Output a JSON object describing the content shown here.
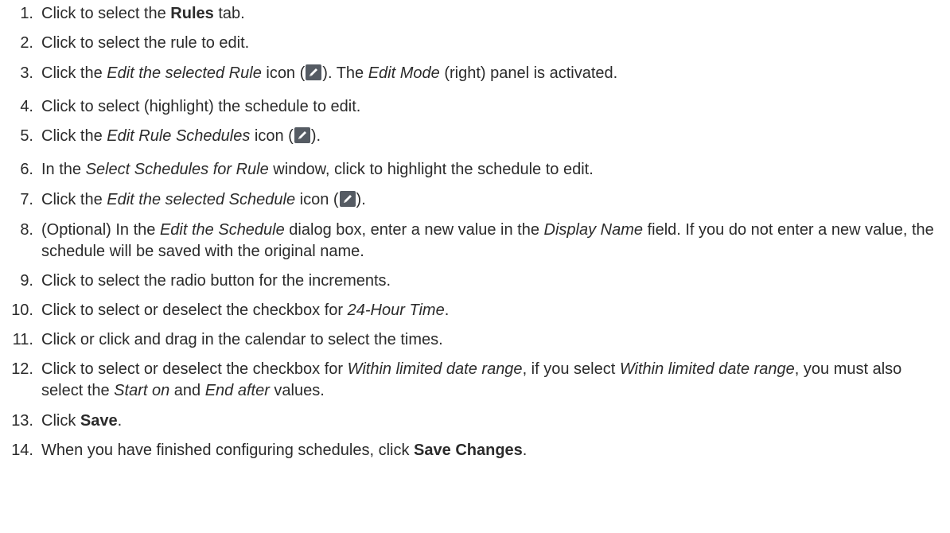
{
  "steps": [
    {
      "num": "1.",
      "parts": [
        {
          "t": "Click to select the "
        },
        {
          "t": "Rules",
          "s": "b"
        },
        {
          "t": " tab."
        }
      ]
    },
    {
      "num": "2.",
      "parts": [
        {
          "t": "Click to select the rule to edit."
        }
      ]
    },
    {
      "num": "3.",
      "parts": [
        {
          "t": "Click the "
        },
        {
          "t": "Edit the selected Rule",
          "s": "i"
        },
        {
          "t": " icon ("
        },
        {
          "icon": "pencil-edit-icon"
        },
        {
          "t": "). The "
        },
        {
          "t": "Edit Mode",
          "s": "i"
        },
        {
          "t": " (right) panel is activated."
        }
      ]
    },
    {
      "num": "4.",
      "parts": [
        {
          "t": "Click to select (highlight) the schedule to edit."
        }
      ]
    },
    {
      "num": "5.",
      "parts": [
        {
          "t": "Click the "
        },
        {
          "t": "Edit Rule Schedules",
          "s": "i"
        },
        {
          "t": " icon ("
        },
        {
          "icon": "pencil-edit-icon"
        },
        {
          "t": ")."
        }
      ]
    },
    {
      "num": "6.",
      "parts": [
        {
          "t": "In the "
        },
        {
          "t": "Select Schedules for Rule",
          "s": "i"
        },
        {
          "t": " window, click to highlight the schedule to edit."
        }
      ]
    },
    {
      "num": "7.",
      "parts": [
        {
          "t": "Click the "
        },
        {
          "t": "Edit the selected Schedule",
          "s": "i"
        },
        {
          "t": " icon ("
        },
        {
          "icon": "pencil-edit-icon"
        },
        {
          "t": ")."
        }
      ]
    },
    {
      "num": "8.",
      "parts": [
        {
          "t": "(Optional) In the "
        },
        {
          "t": "Edit the Schedule",
          "s": "i"
        },
        {
          "t": " dialog box, enter a new value in the "
        },
        {
          "t": "Display Name",
          "s": "i"
        },
        {
          "t": " field. If you do not enter a new value, the schedule will be saved with the original name."
        }
      ]
    },
    {
      "num": "9.",
      "parts": [
        {
          "t": "Click to select the radio button for the increments."
        }
      ]
    },
    {
      "num": "10.",
      "parts": [
        {
          "t": "Click to select or deselect the checkbox for "
        },
        {
          "t": "24-Hour Time",
          "s": "i"
        },
        {
          "t": "."
        }
      ]
    },
    {
      "num": "11.",
      "parts": [
        {
          "t": "Click or click and drag in the calendar to select the times."
        }
      ]
    },
    {
      "num": "12.",
      "parts": [
        {
          "t": "Click to select or deselect the checkbox for "
        },
        {
          "t": "Within limited date range",
          "s": "i"
        },
        {
          "t": ", if you select "
        },
        {
          "t": "Within limited date range",
          "s": "i"
        },
        {
          "t": ", you must also select the "
        },
        {
          "t": "Start on",
          "s": "i"
        },
        {
          "t": " and "
        },
        {
          "t": "End after",
          "s": "i"
        },
        {
          "t": " values."
        }
      ]
    },
    {
      "num": "13.",
      "parts": [
        {
          "t": "Click "
        },
        {
          "t": "Save",
          "s": "b"
        },
        {
          "t": "."
        }
      ]
    },
    {
      "num": "14.",
      "parts": [
        {
          "t": "When you have finished configuring schedules, click "
        },
        {
          "t": "Save Changes",
          "s": "b"
        },
        {
          "t": "."
        }
      ]
    }
  ]
}
